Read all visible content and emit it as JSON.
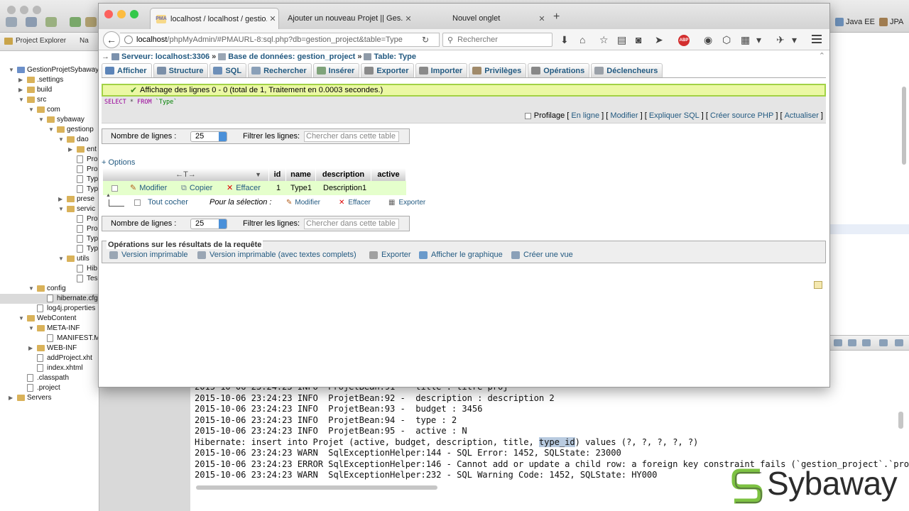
{
  "eclipse": {
    "perspectives": [
      "Java EE",
      "JPA"
    ],
    "explorer_tab": "Project Explorer",
    "explorer_tab2": "Na",
    "tree": [
      {
        "label": "GestionProjetSybaway",
        "depth": 0,
        "arrow": "▼",
        "icon": "proj"
      },
      {
        "label": ".settings",
        "depth": 1,
        "arrow": "▶",
        "icon": "folder"
      },
      {
        "label": "build",
        "depth": 1,
        "arrow": "▶",
        "icon": "folder"
      },
      {
        "label": "src",
        "depth": 1,
        "arrow": "▼",
        "icon": "folder"
      },
      {
        "label": "com",
        "depth": 2,
        "arrow": "▼",
        "icon": "folder"
      },
      {
        "label": "sybaway",
        "depth": 3,
        "arrow": "▼",
        "icon": "folder"
      },
      {
        "label": "gestionp",
        "depth": 4,
        "arrow": "▼",
        "icon": "folder"
      },
      {
        "label": "dao",
        "depth": 5,
        "arrow": "▼",
        "icon": "folder"
      },
      {
        "label": "ent",
        "depth": 6,
        "arrow": "▶",
        "icon": "folder"
      },
      {
        "label": "Pro",
        "depth": 6,
        "arrow": "",
        "icon": "file"
      },
      {
        "label": "Pro",
        "depth": 6,
        "arrow": "",
        "icon": "file"
      },
      {
        "label": "Typ",
        "depth": 6,
        "arrow": "",
        "icon": "file"
      },
      {
        "label": "Typ",
        "depth": 6,
        "arrow": "",
        "icon": "file"
      },
      {
        "label": "prese",
        "depth": 5,
        "arrow": "▶",
        "icon": "folder"
      },
      {
        "label": "servic",
        "depth": 5,
        "arrow": "▼",
        "icon": "folder"
      },
      {
        "label": "Pro",
        "depth": 6,
        "arrow": "",
        "icon": "file"
      },
      {
        "label": "Pro",
        "depth": 6,
        "arrow": "",
        "icon": "file"
      },
      {
        "label": "Typ",
        "depth": 6,
        "arrow": "",
        "icon": "file"
      },
      {
        "label": "Typ",
        "depth": 6,
        "arrow": "",
        "icon": "file"
      },
      {
        "label": "utils",
        "depth": 5,
        "arrow": "▼",
        "icon": "folder"
      },
      {
        "label": "Hib",
        "depth": 6,
        "arrow": "",
        "icon": "file"
      },
      {
        "label": "Tes",
        "depth": 6,
        "arrow": "",
        "icon": "file"
      },
      {
        "label": "config",
        "depth": 2,
        "arrow": "▼",
        "icon": "folder"
      },
      {
        "label": "hibernate.cfg",
        "depth": 3,
        "arrow": "",
        "icon": "file",
        "selected": true
      },
      {
        "label": "log4j.properties",
        "depth": 2,
        "arrow": "",
        "icon": "file"
      },
      {
        "label": "WebContent",
        "depth": 1,
        "arrow": "▼",
        "icon": "folder"
      },
      {
        "label": "META-INF",
        "depth": 2,
        "arrow": "▼",
        "icon": "folder"
      },
      {
        "label": "MANIFEST.M",
        "depth": 3,
        "arrow": "",
        "icon": "file"
      },
      {
        "label": "WEB-INF",
        "depth": 2,
        "arrow": "▶",
        "icon": "folder"
      },
      {
        "label": "addProject.xht",
        "depth": 2,
        "arrow": "",
        "icon": "file"
      },
      {
        "label": "index.xhtml",
        "depth": 2,
        "arrow": "",
        "icon": "file"
      },
      {
        "label": ".classpath",
        "depth": 1,
        "arrow": "",
        "icon": "file"
      },
      {
        "label": ".project",
        "depth": 1,
        "arrow": "",
        "icon": "file"
      },
      {
        "label": "Servers",
        "depth": 0,
        "arrow": "▶",
        "icon": "folder"
      }
    ],
    "console_lines": [
      "2015-10-06 23:24:23 INFO  ProjetBean:91 -  title : titre proj",
      "2015-10-06 23:24:23 INFO  ProjetBean:92 -  description : description 2",
      "2015-10-06 23:24:23 INFO  ProjetBean:93 -  budget : 3456",
      "2015-10-06 23:24:23 INFO  ProjetBean:94 -  type : 2",
      "2015-10-06 23:24:23 INFO  ProjetBean:95 -  active : N",
      "Hibernate: insert into Projet (active, budget, description, title, type_id) values (?, ?, ?, ?, ?)",
      "2015-10-06 23:24:23 WARN  SqlExceptionHelper:144 - SQL Error: 1452, SQLState: 23000",
      "2015-10-06 23:24:23 ERROR SqlExceptionHelper:146 - Cannot add or update a child row: a foreign key constraint fails (`gestion_project`.`pro",
      "2015-10-06 23:24:23 WARN  SqlExceptionHelper:232 - SQL Warning Code: 1452, SQLState: HY000"
    ],
    "console_highlight": "type_id",
    "logo_text": "Sybaway"
  },
  "browser": {
    "tabs": [
      {
        "title": "localhost / localhost / gestio...",
        "favicon": "PMA",
        "active": true
      },
      {
        "title": "Ajouter un nouveau Projet || Ges...",
        "favicon": "",
        "active": false
      },
      {
        "title": "Nouvel onglet",
        "favicon": "",
        "active": false
      }
    ],
    "new_tab": "+",
    "url_host": "localhost",
    "url_rest": "/phpMyAdmin/#PMAURL-8:sql.php?db=gestion_project&table=Type",
    "search_placeholder": "Rechercher",
    "abp_label": "ABP"
  },
  "pma": {
    "breadcrumb": [
      {
        "label": "Serveur: localhost:3306",
        "icon": "server"
      },
      {
        "label": "Base de données: gestion_project",
        "icon": "db"
      },
      {
        "label": "Table: Type",
        "icon": "table"
      }
    ],
    "tabs": [
      {
        "label": "Afficher",
        "active": true,
        "color": "#5c84b8"
      },
      {
        "label": "Structure",
        "active": false,
        "color": "#7b8fa8"
      },
      {
        "label": "SQL",
        "active": false,
        "color": "#6d8fb8"
      },
      {
        "label": "Rechercher",
        "active": false,
        "color": "#8aa0b8"
      },
      {
        "label": "Insérer",
        "active": false,
        "color": "#7fa37a"
      },
      {
        "label": "Exporter",
        "active": false,
        "color": "#8a8a8a"
      },
      {
        "label": "Importer",
        "active": false,
        "color": "#8a8a8a"
      },
      {
        "label": "Privilèges",
        "active": false,
        "color": "#a08a6a"
      },
      {
        "label": "Opérations",
        "active": false,
        "color": "#888888"
      },
      {
        "label": "Déclencheurs",
        "active": false,
        "color": "#9aa0a8"
      }
    ],
    "success_message": "Affichage des lignes 0 - 0 (total de 1, Traitement en 0.0003 secondes.)",
    "sql": {
      "select": "SELECT",
      "star": "*",
      "from": "FROM",
      "table": "`Type`"
    },
    "sql_links": {
      "profiling": "Profilage",
      "inline": "En ligne",
      "edit": "Modifier",
      "explain": "Expliquer SQL",
      "php": "Créer source PHP",
      "refresh": "Actualiser"
    },
    "nav": {
      "rows_label": "Nombre de lignes :",
      "rows_value": "25",
      "filter_label": "Filtrer les lignes:",
      "filter_placeholder": "Chercher dans cette table"
    },
    "options_label": "+ Options",
    "table": {
      "sort_arrows": "←T→",
      "columns": [
        "id",
        "name",
        "description",
        "active"
      ],
      "row": {
        "id": "1",
        "name": "Type1",
        "description": "Description1",
        "active": ""
      },
      "actions": {
        "edit": "Modifier",
        "copy": "Copier",
        "delete": "Effacer"
      }
    },
    "bulk": {
      "check_all": "Tout cocher",
      "for_selection": "Pour la sélection :",
      "edit": "Modifier",
      "delete": "Effacer",
      "export": "Exporter"
    },
    "operations": {
      "legend": "Opérations sur les résultats de la requête",
      "print": "Version imprimable",
      "print_full": "Version imprimable (avec textes complets)",
      "export": "Exporter",
      "chart": "Afficher le graphique",
      "view": "Créer une vue"
    }
  }
}
